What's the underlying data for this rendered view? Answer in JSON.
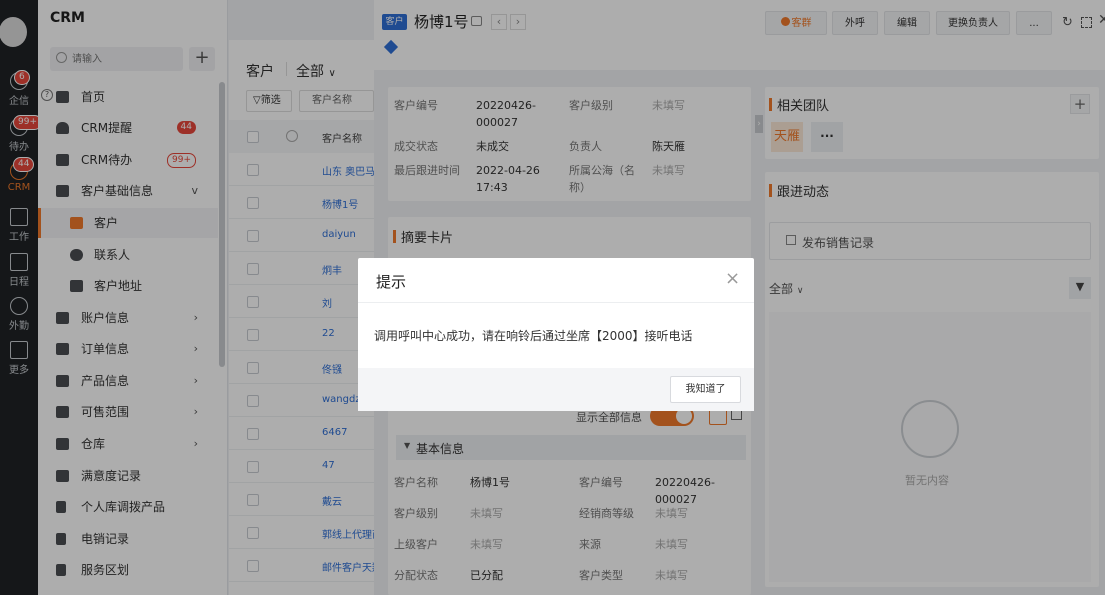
{
  "rail": {
    "items": [
      {
        "label": "企信",
        "badge": "6"
      },
      {
        "label": "待办",
        "badge": "99+"
      },
      {
        "label": "CRM",
        "badge": "44"
      },
      {
        "label": "工作",
        "badge": ""
      },
      {
        "label": "日程",
        "badge": ""
      },
      {
        "label": "外勤",
        "badge": ""
      },
      {
        "label": "更多",
        "badge": ""
      }
    ]
  },
  "nav": {
    "title": "CRM",
    "search_placeholder": "请输入",
    "help_icon": "?",
    "items": [
      {
        "label": "首页",
        "icon": "home-icon"
      },
      {
        "label": "CRM提醒",
        "icon": "bell-icon",
        "count": "44"
      },
      {
        "label": "CRM待办",
        "icon": "todo-icon",
        "count": "99+"
      },
      {
        "label": "客户基础信息",
        "icon": "folder-icon",
        "expanded": "v"
      },
      {
        "label": "客户",
        "icon": "building-icon"
      },
      {
        "label": "联系人",
        "icon": "person-icon"
      },
      {
        "label": "客户地址",
        "icon": "address-icon"
      },
      {
        "label": "账户信息",
        "icon": "folder-icon"
      },
      {
        "label": "订单信息",
        "icon": "folder-icon"
      },
      {
        "label": "产品信息",
        "icon": "folder-icon"
      },
      {
        "label": "可售范围",
        "icon": "folder-icon"
      },
      {
        "label": "仓库",
        "icon": "folder-icon"
      },
      {
        "label": "满意度记录",
        "icon": "chart-icon"
      },
      {
        "label": "个人库调拨产品",
        "icon": "flag-icon"
      },
      {
        "label": "电销记录",
        "icon": "flag-icon"
      },
      {
        "label": "服务区划",
        "icon": "flag-icon"
      }
    ]
  },
  "list": {
    "title": "客户",
    "scope": "全部",
    "filter_label": "筛选",
    "field_label": "客户名称",
    "col_header": "客户名称",
    "rows": [
      "山东 奥巴马",
      "杨博1号",
      "daiyun",
      "炯丰",
      "刘",
      "22",
      "佟镪",
      "wangdz",
      "6467",
      "47",
      "戴云",
      "郭线上代理商",
      "邮件客户天翔"
    ]
  },
  "detail": {
    "tag": "客户",
    "name": "杨博1号",
    "buttons": {
      "group": "客群",
      "call": "外呼",
      "edit": "编辑",
      "change_owner": "更换负责人",
      "more": "..."
    },
    "summary": {
      "code_label": "客户编号",
      "code_value": "20220426-000027",
      "level_label": "客户级别",
      "level_value": "未填写",
      "deal_label": "成交状态",
      "deal_value": "未成交",
      "owner_label": "负责人",
      "owner_value": "陈天雁",
      "follow_label": "最后跟进时间",
      "follow_value": "2022-04-26 17:43",
      "sea_label": "所属公海（名称）",
      "sea_value": "未填写"
    },
    "summary_card_title": "摘要卡片",
    "show_all_label": "显示全部信息",
    "basic_section": "基本信息",
    "basic": [
      {
        "label": "客户名称",
        "value": "杨博1号"
      },
      {
        "label": "客户编号",
        "value": "20220426-000027"
      },
      {
        "label": "客户级别",
        "value": "未填写"
      },
      {
        "label": "经销商等级",
        "value": "未填写"
      },
      {
        "label": "上级客户",
        "value": "未填写"
      },
      {
        "label": "来源",
        "value": "未填写"
      },
      {
        "label": "分配状态",
        "value": "已分配"
      },
      {
        "label": "客户类型",
        "value": "未填写"
      }
    ],
    "team_title": "相关团队",
    "team_member": "天雁",
    "team_more": "···",
    "follow_title": "跟进动态",
    "publish_label": "发布销售记录",
    "scope": "全部",
    "empty_label": "暂无内容"
  },
  "dialog": {
    "title": "提示",
    "message": "调用呼叫中心成功，请在响铃后通过坐席【2000】接听电话",
    "confirm": "我知道了",
    "close": "×"
  },
  "colors": {
    "accent": "#f07a2b",
    "link": "#2f6fd6",
    "badge": "#e8483c",
    "rail": "#1f2326"
  }
}
